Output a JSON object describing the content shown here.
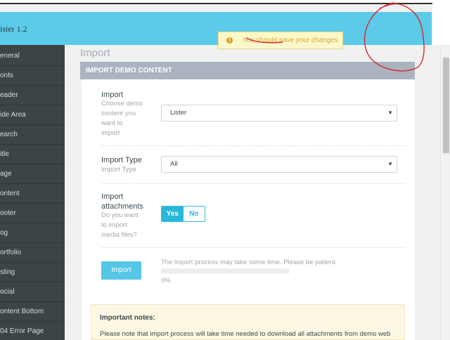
{
  "header": {
    "brand": "ister 1.2",
    "notice": "You should save your changes",
    "notice_icon": "exclamation-icon"
  },
  "sidebar": {
    "items": [
      {
        "label": "eneral"
      },
      {
        "label": "onts"
      },
      {
        "label": "eader"
      },
      {
        "label": "ide Area"
      },
      {
        "label": "earch"
      },
      {
        "label": "itle"
      },
      {
        "label": "age"
      },
      {
        "label": "ontent"
      },
      {
        "label": "ooter"
      },
      {
        "label": "og"
      },
      {
        "label": "ortfolio"
      },
      {
        "label": "sting"
      },
      {
        "label": "ocial"
      },
      {
        "label": "ontent Bottom"
      },
      {
        "label": "04 Error Page"
      }
    ]
  },
  "main": {
    "page_title": "Import",
    "section_title": "IMPORT DEMO CONTENT",
    "import_field": {
      "label": "Import",
      "desc_lines": [
        "Choose demo",
        "content you",
        "want to",
        "import"
      ],
      "value": "Lister"
    },
    "import_type_field": {
      "label": "Import Type",
      "desc": "Import Type",
      "value": "All"
    },
    "attachments_field": {
      "label_lines": [
        "Import",
        "attachments"
      ],
      "desc_lines": [
        "Do you want",
        "to import",
        "media files?"
      ],
      "yes_label": "Yes",
      "no_label": "No",
      "selected": "Yes"
    },
    "import_button": "Import",
    "import_message": "The import process may take some time. Please be patient.",
    "progress_text": "0%",
    "progress": 0,
    "notes": {
      "title": "Important notes:",
      "body": "Please note that import process will take time needed to download all attachments from demo web"
    }
  },
  "colors": {
    "header_bg": "#5bcbe9",
    "sidebar_bg": "#3c4446",
    "accent": "#29b8da",
    "annotation": "#d9262c"
  }
}
